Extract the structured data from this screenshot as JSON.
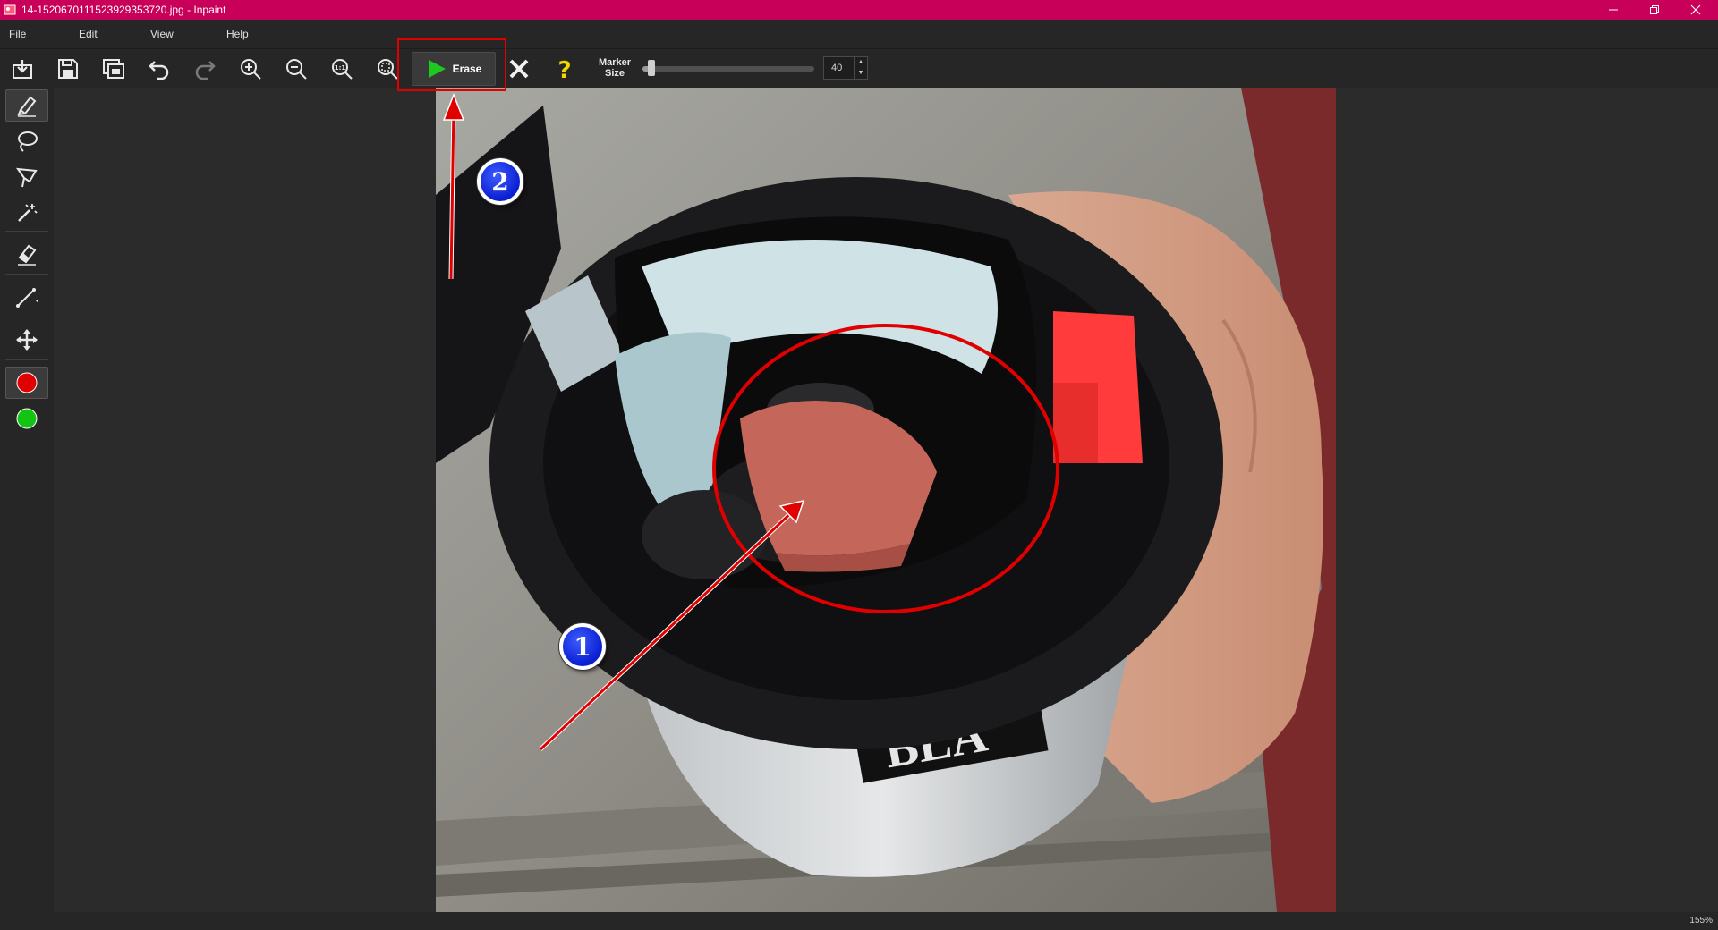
{
  "window": {
    "title": "14-152067011152392935372​0.jpg - Inpaint",
    "controls": [
      "minimize",
      "restore",
      "close"
    ]
  },
  "menu": [
    "File",
    "Edit",
    "View",
    "Help"
  ],
  "toolbar": {
    "buttons": [
      "open-icon",
      "save-icon",
      "batch-icon",
      "undo-icon",
      "redo-icon",
      "zoom-in-icon",
      "zoom-out-icon",
      "zoom-actual-icon",
      "zoom-fit-icon"
    ],
    "erase_label": "Erase",
    "marker_label_line1": "Marker",
    "marker_label_line2": "Size",
    "marker_value": "40",
    "marker_fraction": 0.05
  },
  "tools": [
    "marker-icon",
    "lasso-icon",
    "polygon-lasso-icon",
    "magic-wand-icon",
    "eraser-icon",
    "line-icon",
    "move-icon",
    "red-dot-icon",
    "green-dot-icon"
  ],
  "annotations": {
    "badge_1": "1",
    "badge_2": "2"
  },
  "status": {
    "zoom": "155%"
  },
  "colors": {
    "title_bar": "#c8005a",
    "accent_red": "#e00000",
    "play_green": "#1ec81e",
    "help_yellow": "#f2d600"
  }
}
